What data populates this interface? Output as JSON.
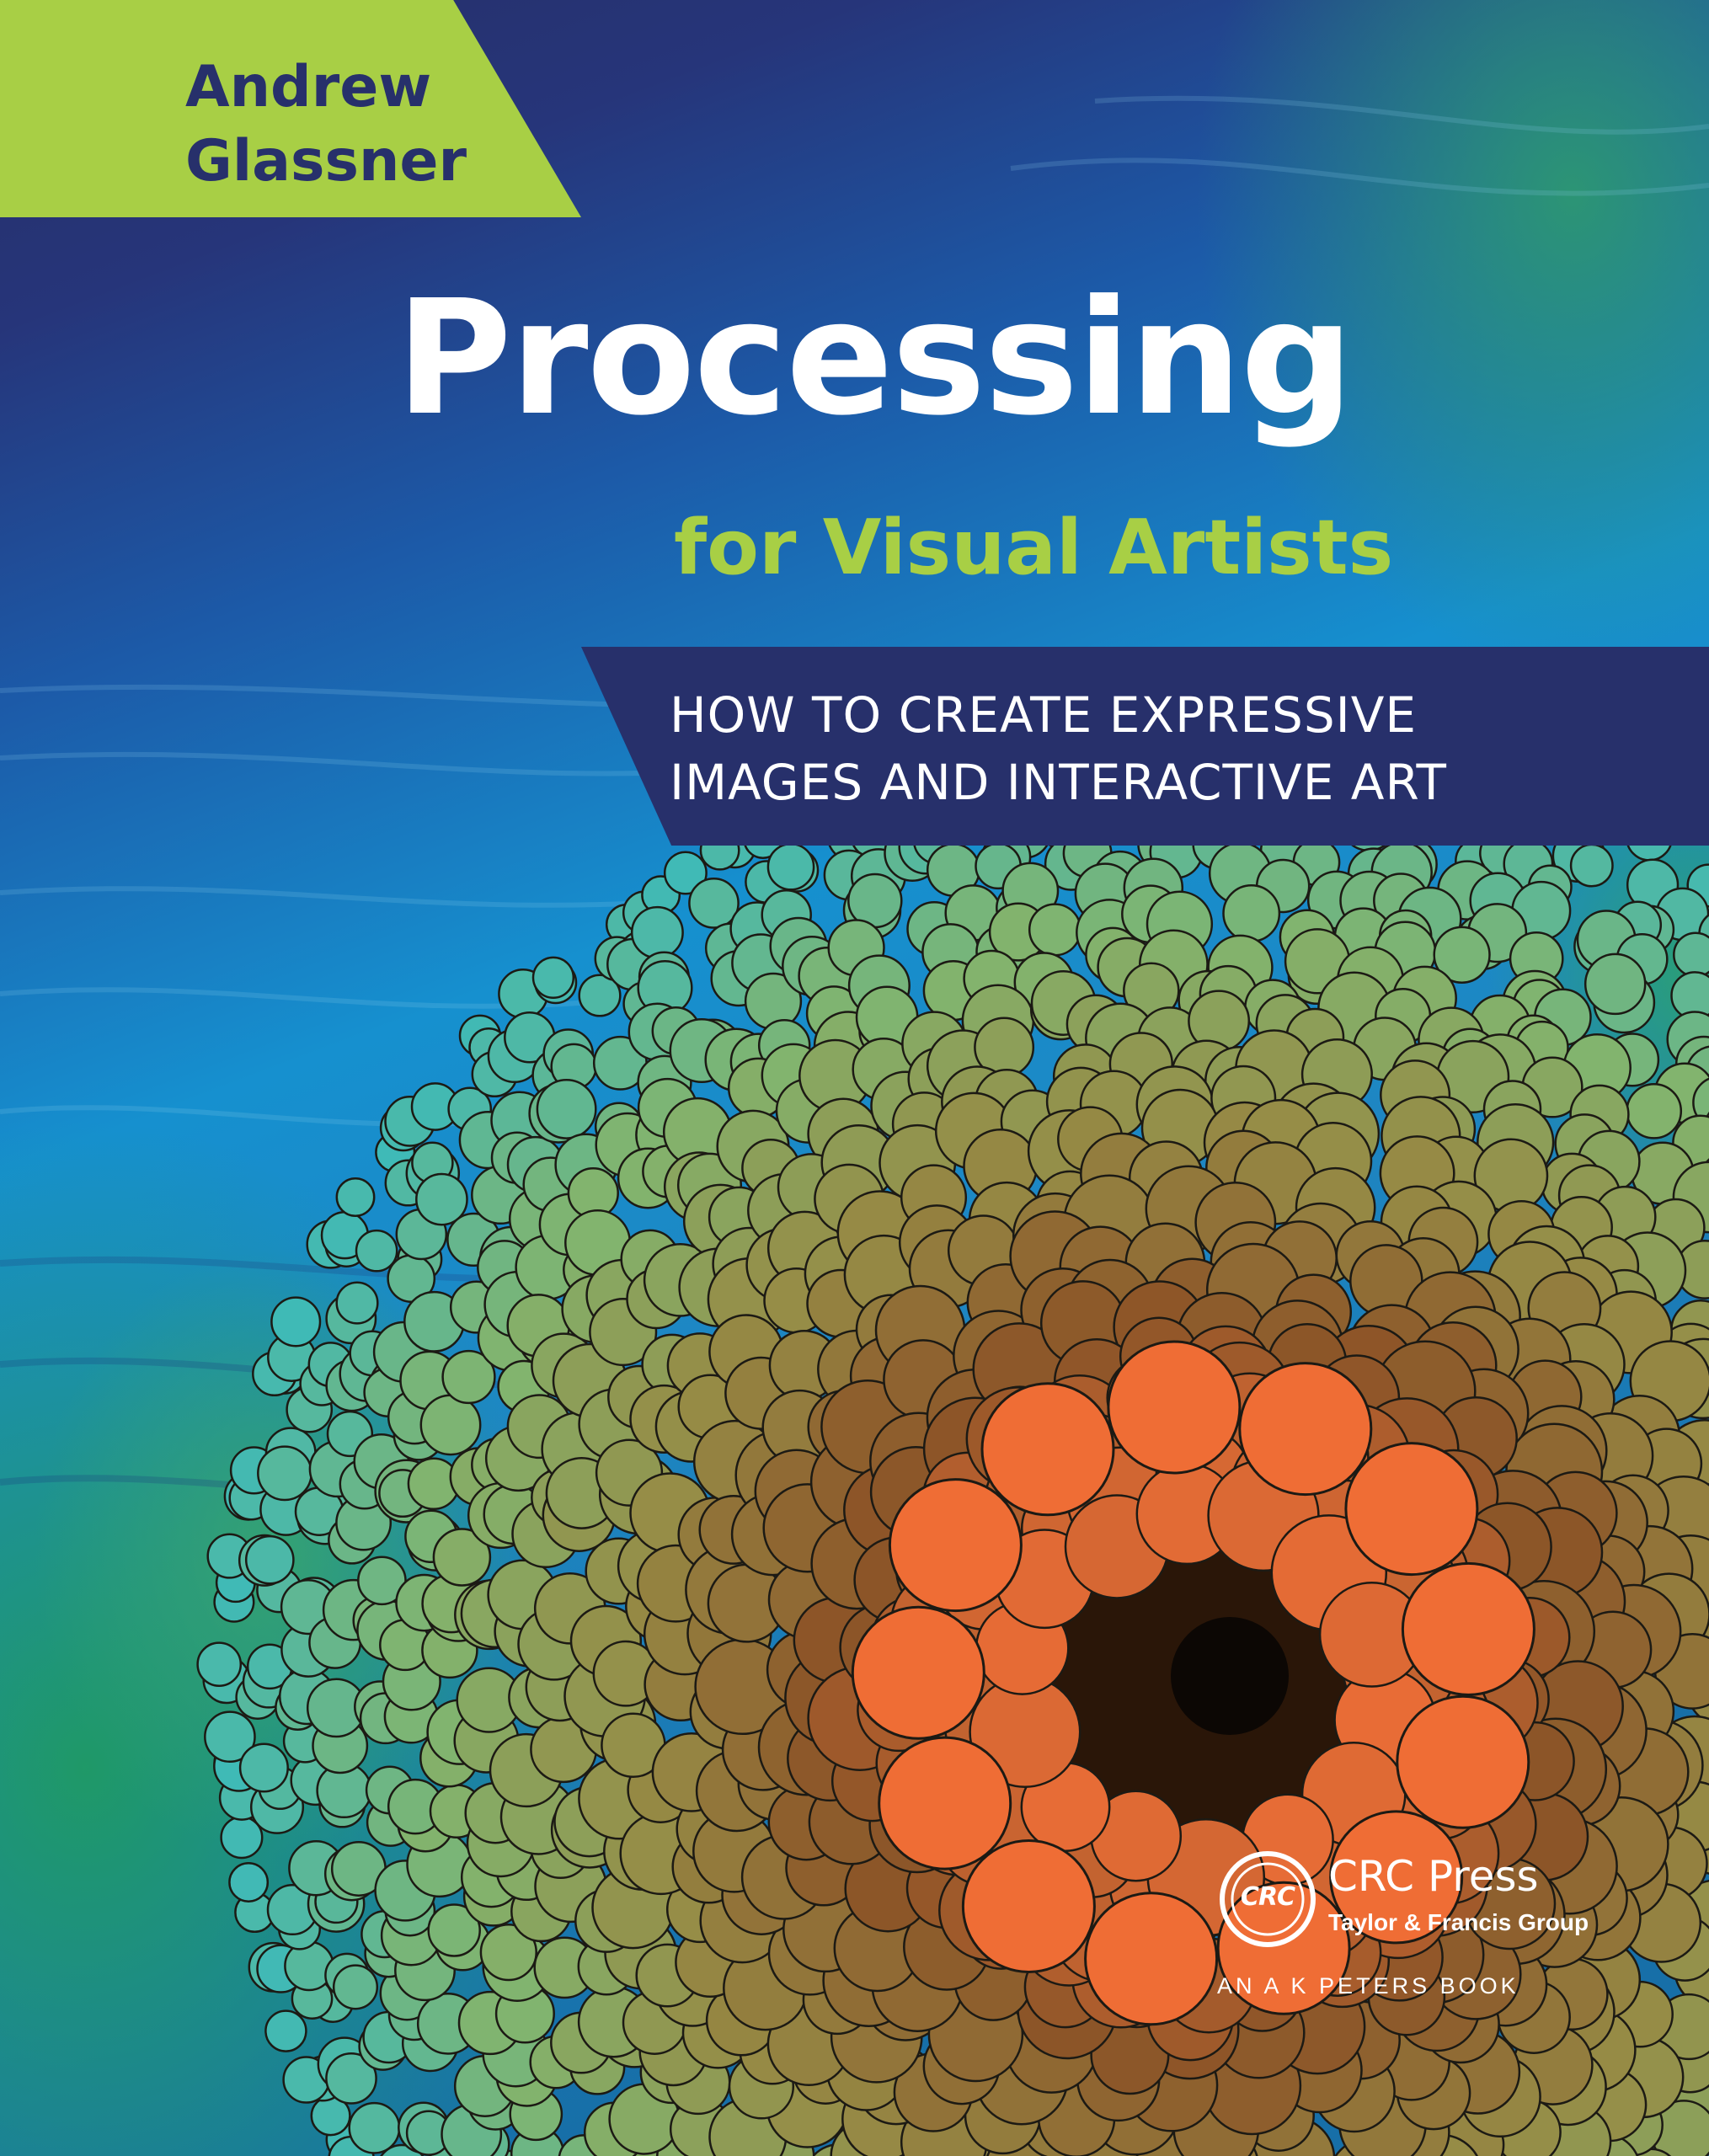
{
  "author": {
    "first_name": "Andrew",
    "last_name": "Glassner"
  },
  "title": "Processing",
  "subtitle": "for Visual Artists",
  "tagline": {
    "line1": "HOW TO CREATE EXPRESSIVE",
    "line2": "IMAGES AND INTERACTIVE ART"
  },
  "publisher": {
    "logo_text": "CRC",
    "name": "CRC Press",
    "group": "Taylor & Francis Group",
    "imprint": "AN A K PETERS BOOK"
  },
  "colors": {
    "navy": "#27306b",
    "lime": "#a8cf45",
    "white": "#ffffff",
    "orange": "#ee6f3a"
  },
  "artwork": {
    "description_icon": "radial-tubes-illustration"
  }
}
